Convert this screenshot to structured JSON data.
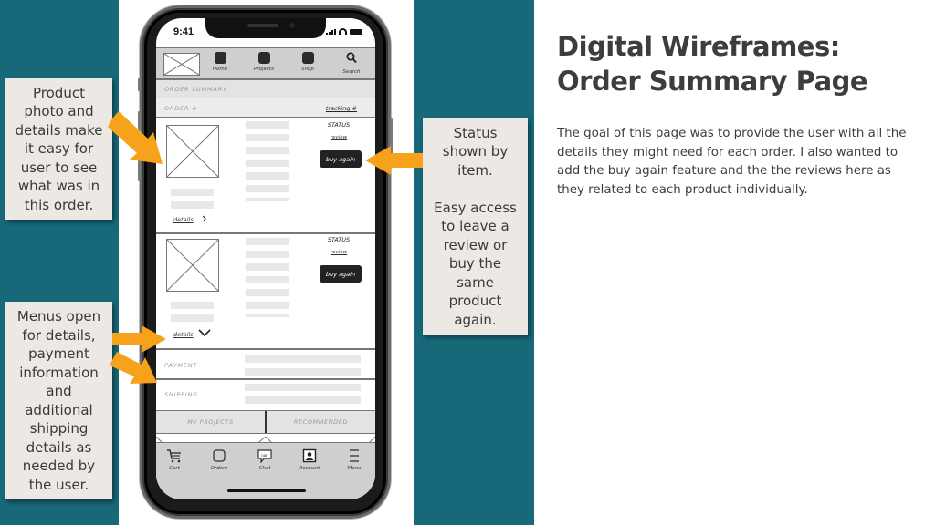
{
  "slide": {
    "title": "Digital Wireframes:\nOrder Summary Page",
    "description": "The goal of this page was to provide the user with all the details they might need for each order.  I also wanted to add the buy again feature and the the reviews here as they related to each product individually.",
    "colors": {
      "teal": "#17697a",
      "note_bg": "#ece8e4",
      "arrow": "#f7a21b",
      "text": "#3d3d3d"
    }
  },
  "annotations": {
    "product": "Product\nphoto and\ndetails make\nit easy for\nuser to see\nwhat was in\nthis order.",
    "status": "Status\nshown by\nitem.\n\nEasy access\nto leave a\nreview or\nbuy the\nsame\nproduct\nagain.",
    "menus": "Menus open\nfor details,\npayment\ninformation\nand\nadditional\nshipping\ndetails as\nneeded by\nthe user."
  },
  "phone": {
    "status_bar": {
      "time": "9:41"
    },
    "top_nav": [
      {
        "label": "Home",
        "icon": "square-icon"
      },
      {
        "label": "Projects",
        "icon": "square-icon"
      },
      {
        "label": "Shop",
        "icon": "square-icon"
      },
      {
        "label": "Search",
        "icon": "search-icon",
        "glyph": "⌕"
      }
    ],
    "order_summary_label": "ORDER SUMMARY",
    "order_number_label": "ORDER #",
    "tracking_label": "tracking #",
    "items": [
      {
        "status": "STATUS",
        "review": "review",
        "buy_again": "buy again",
        "details": "details",
        "details_state": "collapsed",
        "chevron": "›"
      },
      {
        "status": "STATUS",
        "review": "review",
        "buy_again": "buy again",
        "details": "details",
        "details_state": "expanded",
        "chevron": "⌄"
      }
    ],
    "payment_label": "PAYMENT",
    "shipping_label": "SHIPPING",
    "tabs": [
      "MY PROJECTS",
      "RECOMMENDED"
    ],
    "bottom_nav": [
      {
        "label": "Cart",
        "icon": "cart-icon"
      },
      {
        "label": "Orders",
        "icon": "orders-icon"
      },
      {
        "label": "Chat",
        "icon": "chat-icon",
        "bubble_text": "nan"
      },
      {
        "label": "Account",
        "icon": "account-icon"
      },
      {
        "label": "Menu",
        "icon": "menu-icon"
      }
    ]
  }
}
